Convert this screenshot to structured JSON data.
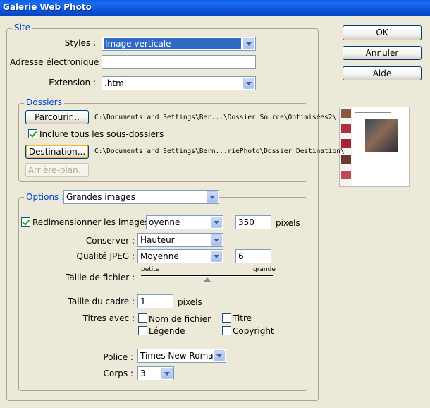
{
  "window": {
    "title": "Galerie Web Photo"
  },
  "buttons": {
    "ok": "OK",
    "cancel": "Annuler",
    "help": "Aide"
  },
  "site": {
    "legend": "Site",
    "styles_label": "Styles :",
    "styles_value": "Image verticale",
    "email_label": "Adresse électronique :",
    "email_value": "",
    "extension_label": "Extension :",
    "extension_value": ".html"
  },
  "folders": {
    "legend": "Dossiers",
    "browse_label": "Parcourir...",
    "source_path": "C:\\Documents and Settings\\Ber...\\Dossier Source\\Optimisées2\\",
    "include_subfolders_label": "Inclure tous les sous-dossiers",
    "include_subfolders_checked": true,
    "destination_label": "Destination...",
    "destination_path": "C:\\Documents and Settings\\Bern...riePhoto\\Dossier Destination\\",
    "background_label": "Arrière-plan..."
  },
  "options": {
    "legend": "Options :",
    "mode_value": "Grandes images",
    "resize_label": "Redimensionner les images :",
    "resize_checked": true,
    "resize_size_value": "oyenne",
    "resize_pixels_value": "350",
    "pixels_unit": "pixels",
    "constrain_label": "Conserver :",
    "constrain_value": "Hauteur",
    "jpeg_label": "Qualité JPEG :",
    "jpeg_value": "Moyenne",
    "jpeg_number": "6",
    "filesize_label": "Taille de fichier :",
    "filesize_small": "petite",
    "filesize_large": "grande",
    "filesize_level": 0.5,
    "border_label": "Taille du cadre :",
    "border_value": "1",
    "border_unit": "pixels",
    "titles_label": "Titres avec :",
    "title_filename": "Nom de fichier",
    "title_title": "Titre",
    "title_caption": "Légende",
    "title_copyright": "Copyright",
    "font_label": "Police :",
    "font_value": "Times New Roman",
    "size_label": "Corps :",
    "size_value": "3"
  },
  "preview": {
    "caption": ""
  },
  "colors": {
    "accent": "#0046d5",
    "titlebar": "#0a5ee6",
    "dialog_bg": "#ece9d8"
  }
}
